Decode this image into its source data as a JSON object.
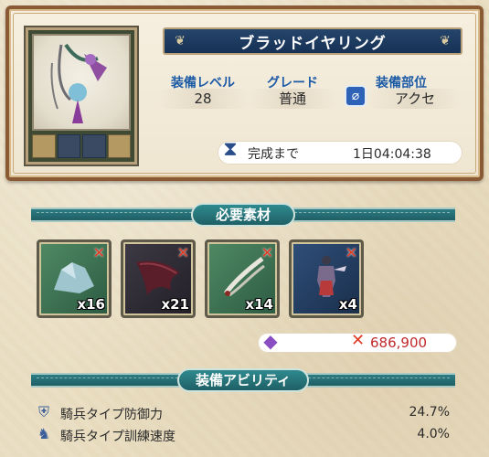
{
  "item": {
    "name": "ブラッドイヤリング",
    "stats": [
      {
        "label": "装備レベル",
        "value": "28"
      },
      {
        "label": "グレード",
        "value": "普通"
      },
      {
        "label": "装備部位",
        "value": "アクセ",
        "icon": "accessory-icon"
      }
    ],
    "timer": {
      "label": "完成まで",
      "value": "1日04:04:38",
      "icon": "hourglass-icon"
    }
  },
  "materials_section": {
    "title": "必要素材",
    "items": [
      {
        "count": "x16",
        "icon": "stone-material-icon"
      },
      {
        "count": "x21",
        "icon": "wing-material-icon"
      },
      {
        "count": "x14",
        "icon": "feather-material-icon"
      },
      {
        "count": "x4",
        "icon": "figure-material-icon"
      }
    ],
    "cost": {
      "value": "686,900",
      "icon": "crystal-icon",
      "status_mark": "✕"
    }
  },
  "ability_section": {
    "title": "装備アビリティ",
    "items": [
      {
        "name": "騎兵タイプ防御力",
        "value": "24.7%",
        "icon": "shield-icon"
      },
      {
        "name": "騎兵タイプ訓練速度",
        "value": "4.0%",
        "icon": "cavalry-icon"
      }
    ]
  },
  "colors": {
    "accent_blue": "#1c5aa6",
    "banner_navy": "#163155",
    "teal_header": "#1e6065",
    "missing_red": "#e03a23",
    "cost_red": "#c0282a"
  }
}
